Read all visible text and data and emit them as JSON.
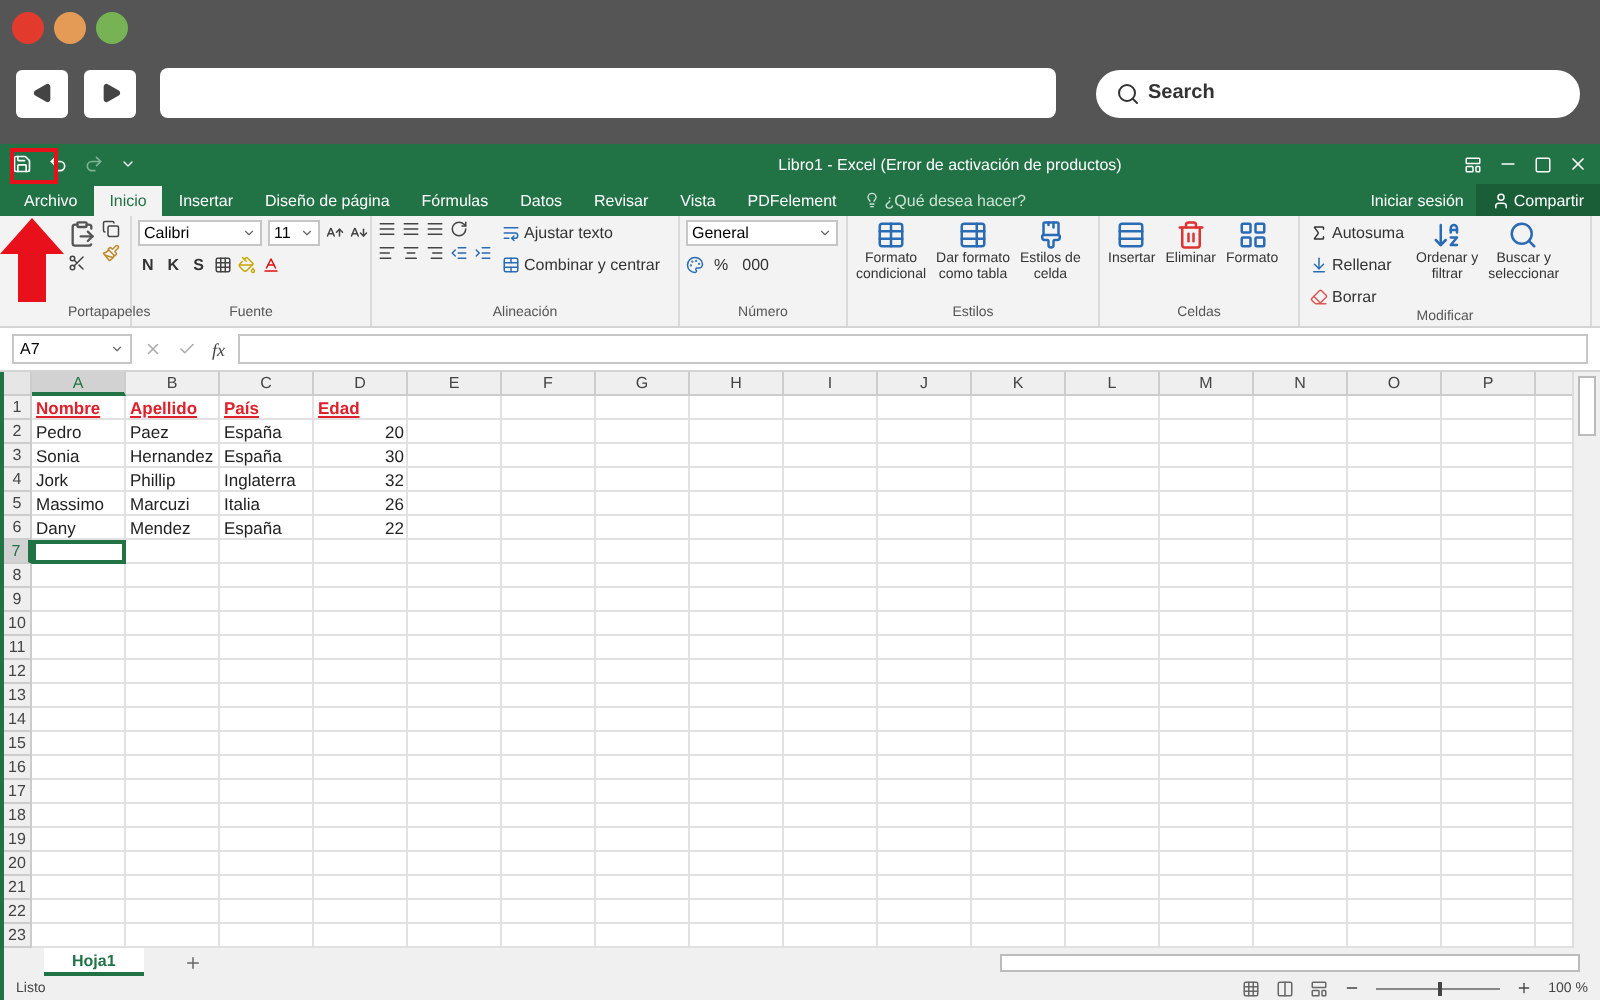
{
  "browser": {
    "search": {
      "placeholder": "Search"
    }
  },
  "window": {
    "title": "Libro1 - Excel (Error de activación de productos)"
  },
  "tabs": [
    {
      "label": "Archivo",
      "selected": false
    },
    {
      "label": "Inicio",
      "selected": true
    },
    {
      "label": "Insertar",
      "selected": false
    },
    {
      "label": "Diseño de página",
      "selected": false
    },
    {
      "label": "Fórmulas",
      "selected": false
    },
    {
      "label": "Datos",
      "selected": false
    },
    {
      "label": "Revisar",
      "selected": false
    },
    {
      "label": "Vista",
      "selected": false
    },
    {
      "label": "PDFelement",
      "selected": false
    }
  ],
  "tell_me": "¿Qué desea hacer?",
  "sign_in": "Iniciar sesión",
  "share": "Compartir",
  "ribbon": {
    "font": {
      "name": "Calibri",
      "size": "11",
      "styles": [
        "N",
        "K",
        "S"
      ],
      "label": "Fuente"
    },
    "clipboard": {
      "label": "Portapapeles"
    },
    "alignment": {
      "wrap": "Ajustar texto",
      "merge": "Combinar y centrar",
      "label": "Alineación"
    },
    "number": {
      "format": "General",
      "percent": "%",
      "thousands": "000",
      "label": "Número"
    },
    "styles": {
      "buttons": [
        "Formato\ncondicional",
        "Dar formato\ncomo tabla",
        "Estilos de\ncelda"
      ],
      "label": "Estilos"
    },
    "cells": {
      "buttons": [
        "Insertar",
        "Eliminar",
        "Formato"
      ],
      "label": "Celdas"
    },
    "editing": {
      "items": [
        "Autosuma",
        "Rellenar",
        "Borrar"
      ],
      "buttons": [
        "Ordenar y\nfiltrar",
        "Buscar y\nseleccionar"
      ],
      "label": "Modificar"
    }
  },
  "name_box": "A7",
  "formula_symbol": "fx",
  "columns": [
    {
      "label": "A",
      "selected": true
    },
    {
      "label": "B",
      "selected": false
    },
    {
      "label": "C",
      "selected": false
    },
    {
      "label": "D",
      "selected": false
    },
    {
      "label": "E",
      "selected": false
    },
    {
      "label": "F",
      "selected": false
    },
    {
      "label": "G",
      "selected": false
    },
    {
      "label": "H",
      "selected": false
    },
    {
      "label": "I",
      "selected": false
    },
    {
      "label": "J",
      "selected": false
    },
    {
      "label": "K",
      "selected": false
    },
    {
      "label": "L",
      "selected": false
    },
    {
      "label": "M",
      "selected": false
    },
    {
      "label": "N",
      "selected": false
    },
    {
      "label": "O",
      "selected": false
    },
    {
      "label": "P",
      "selected": false
    }
  ],
  "rows": [
    {
      "label": "1",
      "selected": false,
      "kind": "header",
      "cells": [
        {
          "text": "Nombre",
          "kind": "text"
        },
        {
          "text": "Apellido",
          "kind": "text"
        },
        {
          "text": "País",
          "kind": "text"
        },
        {
          "text": "Edad",
          "kind": "text"
        }
      ]
    },
    {
      "label": "2",
      "selected": false,
      "kind": "data",
      "cells": [
        {
          "text": "Pedro",
          "kind": "text"
        },
        {
          "text": "Paez",
          "kind": "text"
        },
        {
          "text": "España",
          "kind": "text"
        },
        {
          "text": "20",
          "kind": "number"
        }
      ]
    },
    {
      "label": "3",
      "selected": false,
      "kind": "data",
      "cells": [
        {
          "text": "Sonia",
          "kind": "text"
        },
        {
          "text": "Hernandez",
          "kind": "text"
        },
        {
          "text": "España",
          "kind": "text"
        },
        {
          "text": "30",
          "kind": "number"
        }
      ]
    },
    {
      "label": "4",
      "selected": false,
      "kind": "data",
      "cells": [
        {
          "text": "Jork",
          "kind": "text"
        },
        {
          "text": "Phillip",
          "kind": "text"
        },
        {
          "text": "Inglaterra",
          "kind": "text"
        },
        {
          "text": "32",
          "kind": "number"
        }
      ]
    },
    {
      "label": "5",
      "selected": false,
      "kind": "data",
      "cells": [
        {
          "text": "Massimo",
          "kind": "text"
        },
        {
          "text": "Marcuzi",
          "kind": "text"
        },
        {
          "text": "Italia",
          "kind": "text"
        },
        {
          "text": "26",
          "kind": "number"
        }
      ]
    },
    {
      "label": "6",
      "selected": false,
      "kind": "data",
      "cells": [
        {
          "text": "Dany",
          "kind": "text"
        },
        {
          "text": "Mendez",
          "kind": "text"
        },
        {
          "text": "España",
          "kind": "text"
        },
        {
          "text": "22",
          "kind": "number"
        }
      ]
    },
    {
      "label": "7",
      "selected": true,
      "kind": "data",
      "cells": []
    },
    {
      "label": "8",
      "selected": false,
      "kind": "data",
      "cells": []
    },
    {
      "label": "9",
      "selected": false,
      "kind": "data",
      "cells": []
    },
    {
      "label": "10",
      "selected": false,
      "kind": "data",
      "cells": []
    },
    {
      "label": "11",
      "selected": false,
      "kind": "data",
      "cells": []
    },
    {
      "label": "12",
      "selected": false,
      "kind": "data",
      "cells": []
    },
    {
      "label": "13",
      "selected": false,
      "kind": "data",
      "cells": []
    },
    {
      "label": "14",
      "selected": false,
      "kind": "data",
      "cells": []
    },
    {
      "label": "15",
      "selected": false,
      "kind": "data",
      "cells": []
    },
    {
      "label": "16",
      "selected": false,
      "kind": "data",
      "cells": []
    },
    {
      "label": "17",
      "selected": false,
      "kind": "data",
      "cells": []
    },
    {
      "label": "18",
      "selected": false,
      "kind": "data",
      "cells": []
    },
    {
      "label": "19",
      "selected": false,
      "kind": "data",
      "cells": []
    },
    {
      "label": "20",
      "selected": false,
      "kind": "data",
      "cells": []
    },
    {
      "label": "21",
      "selected": false,
      "kind": "data",
      "cells": []
    },
    {
      "label": "22",
      "selected": false,
      "kind": "data",
      "cells": []
    },
    {
      "label": "23",
      "selected": false,
      "kind": "data",
      "cells": []
    }
  ],
  "sheets": [
    {
      "label": "Hoja1",
      "selected": true
    }
  ],
  "status": {
    "text": "Listo",
    "zoom": "100 %",
    "zoom_level": {
      "level": 0.5
    }
  }
}
